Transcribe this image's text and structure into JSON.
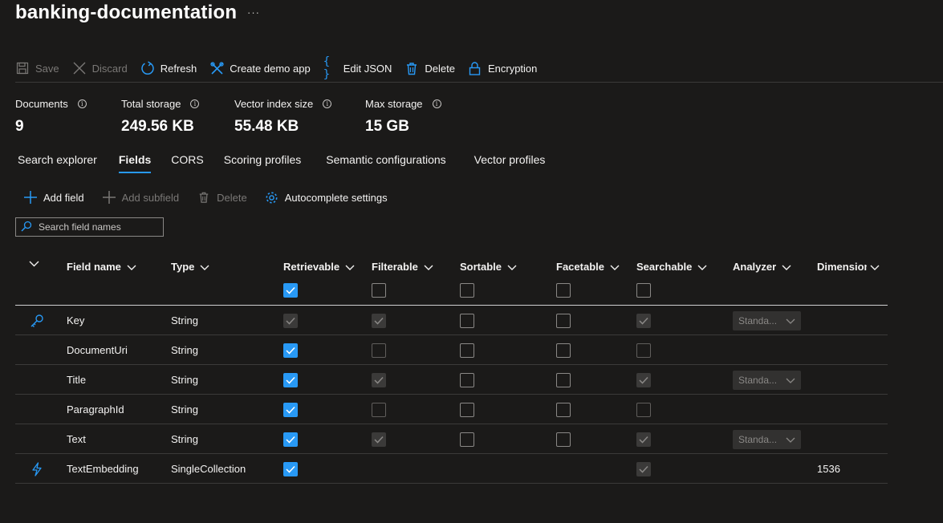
{
  "header": {
    "title": "banking-documentation",
    "more": "···"
  },
  "toolbar": {
    "save": "Save",
    "discard": "Discard",
    "refresh": "Refresh",
    "demo": "Create demo app",
    "json": "Edit JSON",
    "delete": "Delete",
    "encryption": "Encryption"
  },
  "stats": [
    {
      "label": "Documents",
      "value": "9"
    },
    {
      "label": "Total storage",
      "value": "249.56 KB"
    },
    {
      "label": "Vector index size",
      "value": "55.48 KB"
    },
    {
      "label": "Max storage",
      "value": "15 GB"
    }
  ],
  "tabs": [
    "Search explorer",
    "Fields",
    "CORS",
    "Scoring profiles",
    "Semantic configurations",
    "Vector profiles"
  ],
  "fields_toolbar": {
    "add_field": "Add field",
    "add_subfield": "Add subfield",
    "delete": "Delete",
    "autocomplete": "Autocomplete settings"
  },
  "search": {
    "placeholder": "Search field names"
  },
  "columns": [
    "Field name",
    "Type",
    "Retrievable",
    "Filterable",
    "Sortable",
    "Facetable",
    "Searchable",
    "Analyzer",
    "Dimension"
  ],
  "rows": [
    {
      "icon": "key-icon",
      "name": "Key",
      "type": "String",
      "analyzer": "Standa...",
      "dimension": ""
    },
    {
      "icon": "",
      "name": "DocumentUri",
      "type": "String",
      "analyzer": "",
      "dimension": ""
    },
    {
      "icon": "",
      "name": "Title",
      "type": "String",
      "analyzer": "Standa...",
      "dimension": ""
    },
    {
      "icon": "",
      "name": "ParagraphId",
      "type": "String",
      "analyzer": "",
      "dimension": ""
    },
    {
      "icon": "",
      "name": "Text",
      "type": "String",
      "analyzer": "Standa...",
      "dimension": ""
    },
    {
      "icon": "lightning-icon",
      "name": "TextEmbedding",
      "type": "SingleCollection",
      "analyzer": "",
      "dimension": "1536"
    }
  ],
  "colors": {
    "accent": "#2899f5",
    "background": "#1b1a19",
    "disabled": "#7a7876"
  }
}
